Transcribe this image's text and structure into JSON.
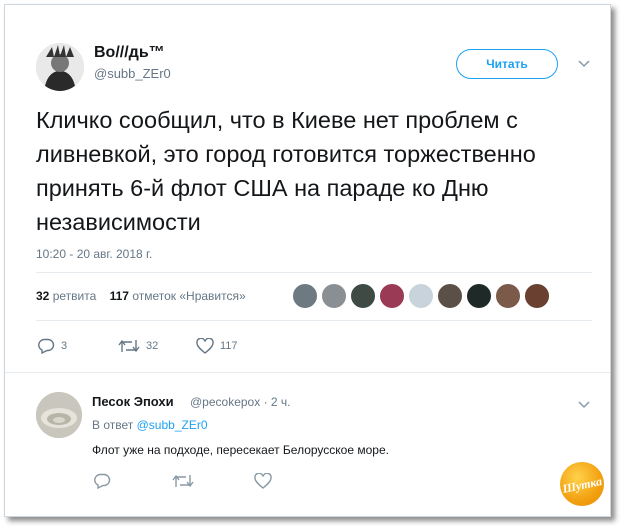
{
  "tweet": {
    "author_name": "Во///дь™",
    "author_handle": "@subb_ZEr0",
    "follow_label": "Читать",
    "text": "Кличко сообщил, что в Киеве нет проблем с ливневкой, это город готовится торжественно принять 6-й флот США на параде ко Дню независимости",
    "timestamp": "10:20 - 20 авг. 2018 г.",
    "retweets_count": "32",
    "retweets_label": "ретвита",
    "likes_count": "117",
    "likes_label": "отметок «Нравится»",
    "replies_action": "3",
    "retweets_action": "32",
    "likes_action": "117"
  },
  "reply": {
    "author_name": "Песок Эпохи",
    "author_handle": "@pecokepox",
    "time": "2 ч.",
    "in_reply_prefix": "В ответ",
    "in_reply_handle": "@subb_ZEr0",
    "text": "Флот уже на подходе, пересекает Белорусское море."
  },
  "colors": {
    "accent": "#1da1f2",
    "text": "#14171a",
    "muted": "#657786",
    "watermark": "#f2a010"
  },
  "icons": [
    "chevron-down-icon",
    "reply-icon",
    "retweet-icon",
    "like-icon"
  ],
  "watermark": {
    "text": "Шутка"
  }
}
